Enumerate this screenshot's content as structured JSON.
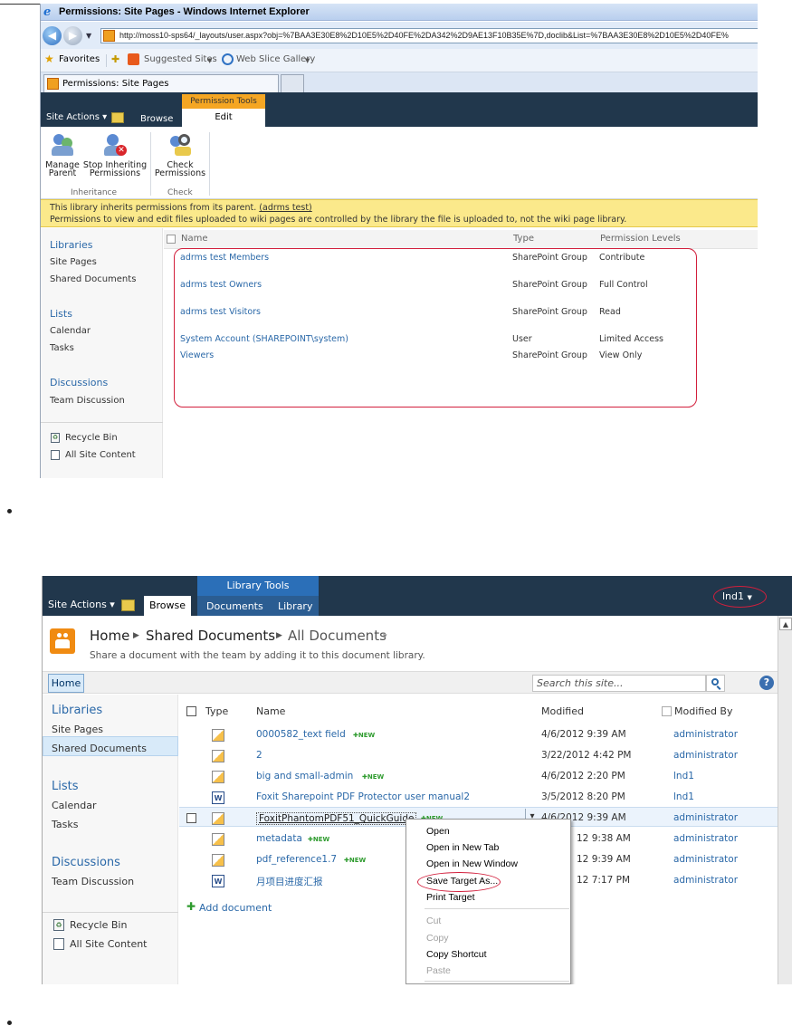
{
  "shot1": {
    "window_title": "Permissions: Site Pages - Windows Internet Explorer",
    "address": "http://moss10-sps64/_layouts/user.aspx?obj=%7BAA3E30E8%2D10E5%2D40FE%2DA342%2D9AE13F10B35E%7D,doclib&List=%7BAA3E30E8%2D10E5%2D40FE%",
    "favorites": "Favorites",
    "suggested_sites": "Suggested Sites",
    "web_slice_gallery": "Web Slice Gallery",
    "tab_title": "Permissions: Site Pages",
    "site_actions": "Site Actions",
    "browse_tab": "Browse",
    "permission_tools": "Permission Tools",
    "edit_tab": "Edit",
    "ribbon": {
      "manage_parent_1": "Manage",
      "manage_parent_2": "Parent",
      "stop_inherit_1": "Stop Inheriting",
      "stop_inherit_2": "Permissions",
      "check_perm_1": "Check",
      "check_perm_2": "Permissions",
      "group_inheritance": "Inheritance",
      "group_check": "Check"
    },
    "notice": {
      "line1": "This library inherits permissions from its parent.",
      "link": "(adrms test)",
      "line2": "Permissions to view and edit files uploaded to wiki pages are controlled by the library the file is uploaded to, not the wiki page library."
    },
    "nav": {
      "libraries": "Libraries",
      "site_pages": "Site Pages",
      "shared_documents": "Shared Documents",
      "lists": "Lists",
      "calendar": "Calendar",
      "tasks": "Tasks",
      "discussions": "Discussions",
      "team_discussion": "Team Discussion",
      "recycle_bin": "Recycle Bin",
      "all_site_content": "All Site Content"
    },
    "columns": {
      "name": "Name",
      "type": "Type",
      "levels": "Permission Levels"
    },
    "rows": [
      {
        "name": "adrms test Members",
        "type": "SharePoint Group",
        "level": "Contribute"
      },
      {
        "name": "adrms test Owners",
        "type": "SharePoint Group",
        "level": "Full Control"
      },
      {
        "name": "adrms test Visitors",
        "type": "SharePoint Group",
        "level": "Read"
      },
      {
        "name": "System Account (SHAREPOINT\\system)",
        "type": "User",
        "level": "Limited Access"
      },
      {
        "name": "Viewers",
        "type": "SharePoint Group",
        "level": "View Only"
      }
    ]
  },
  "shot2": {
    "site_actions": "Site Actions",
    "browse_tab": "Browse",
    "library_tools": "Library Tools",
    "documents_tab": "Documents",
    "library_tab": "Library",
    "user": "lnd1",
    "breadcrumb": {
      "home": "Home",
      "lib": "Shared Documents",
      "view": "All Documents"
    },
    "description": "Share a document with the team by adding it to this document library.",
    "home_tab": "Home",
    "search_placeholder": "Search this site...",
    "nav": {
      "libraries": "Libraries",
      "site_pages": "Site Pages",
      "shared_documents": "Shared Documents",
      "lists": "Lists",
      "calendar": "Calendar",
      "tasks": "Tasks",
      "discussions": "Discussions",
      "team_discussion": "Team Discussion",
      "recycle_bin": "Recycle Bin",
      "all_site_content": "All Site Content"
    },
    "columns": {
      "type": "Type",
      "name": "Name",
      "modified": "Modified",
      "modified_by": "Modified By"
    },
    "new_badge": "NEW",
    "rows": [
      {
        "name": "0000582_text field",
        "modified": "4/6/2012 9:39 AM",
        "by": "administrator"
      },
      {
        "name": "2",
        "modified": "3/22/2012 4:42 PM",
        "by": "administrator"
      },
      {
        "name": "big and small-admin",
        "modified": "4/6/2012 2:20 PM",
        "by": "lnd1"
      },
      {
        "name": "Foxit Sharepoint PDF Protector user manual2",
        "modified": "3/5/2012 8:20 PM",
        "by": "lnd1"
      },
      {
        "name": "FoxitPhantomPDF51_QuickGuide",
        "modified": "4/6/2012 9:39 AM",
        "by": "administrator"
      },
      {
        "name": "metadata",
        "modified": "12 9:38 AM",
        "by": "administrator"
      },
      {
        "name": "pdf_reference1.7",
        "modified": "12 9:39 AM",
        "by": "administrator"
      },
      {
        "name": "月项目进度汇报",
        "modified": "12 7:17 PM",
        "by": "administrator"
      }
    ],
    "add_document": "Add document",
    "context_menu": {
      "open": "Open",
      "open_new_tab": "Open in New Tab",
      "open_new_window": "Open in New Window",
      "save_target": "Save Target As...",
      "print_target": "Print Target",
      "cut": "Cut",
      "copy": "Copy",
      "copy_shortcut": "Copy Shortcut",
      "paste": "Paste"
    },
    "annotation_color": "#d21f3c"
  }
}
